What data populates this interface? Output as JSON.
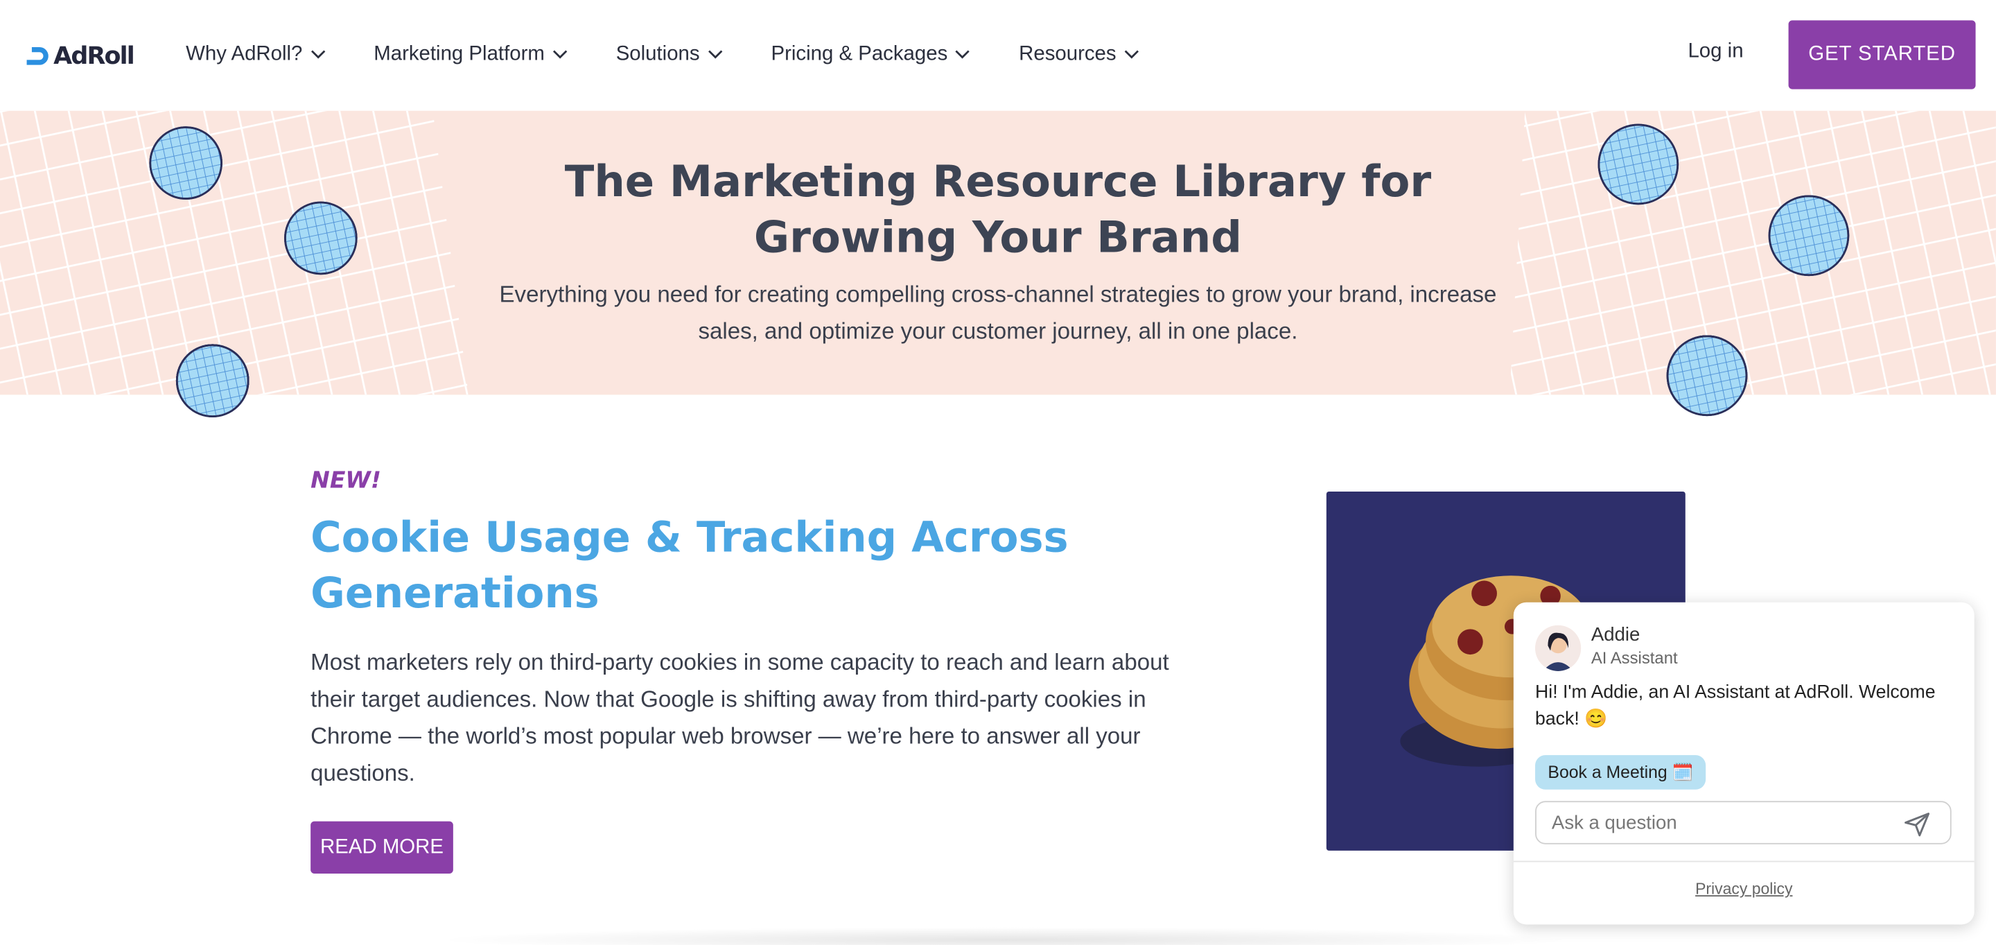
{
  "header": {
    "logo_text": "AdRoll",
    "nav": [
      {
        "label": "Why AdRoll?",
        "icon": "chevron-down-icon"
      },
      {
        "label": "Marketing Platform",
        "icon": "chevron-down-icon"
      },
      {
        "label": "Solutions",
        "icon": "chevron-down-icon"
      },
      {
        "label": "Pricing & Packages",
        "icon": "chevron-down-icon"
      },
      {
        "label": "Resources",
        "icon": "chevron-down-icon"
      }
    ],
    "login_label": "Log in",
    "cta_label": "GET STARTED"
  },
  "hero": {
    "title": "The Marketing Resource Library for Growing Your Brand",
    "subtitle": "Everything you need for creating compelling cross-channel strategies to grow your brand, increase sales, and optimize your customer journey, all in one place."
  },
  "article": {
    "tag": "NEW!",
    "title": "Cookie Usage & Tracking Across Generations",
    "body": "Most marketers rely on third-party cookies in some capacity to reach and learn about their target audiences. Now that Google is shifting away from third-party cookies in Chrome — the world’s most popular web browser — we’re here to answer all your questions.",
    "button_label": "READ MORE",
    "image_icon": "cookie-stack-illustration"
  },
  "chat": {
    "name": "Addie",
    "role": "AI Assistant",
    "message": "Hi! I'm Addie, an AI Assistant at AdRoll. Welcome back! 😊",
    "chip_label": "Book a Meeting 🗓️",
    "input_placeholder": "Ask a question",
    "send_icon": "send-icon",
    "privacy_label": "Privacy policy"
  },
  "colors": {
    "brand_purple": "#8a3fa8",
    "hero_bg": "#fbe6df",
    "title_blue": "#4ba6e3",
    "image_bg": "#2e2f6b",
    "chip_bg": "#b8e1f3"
  }
}
